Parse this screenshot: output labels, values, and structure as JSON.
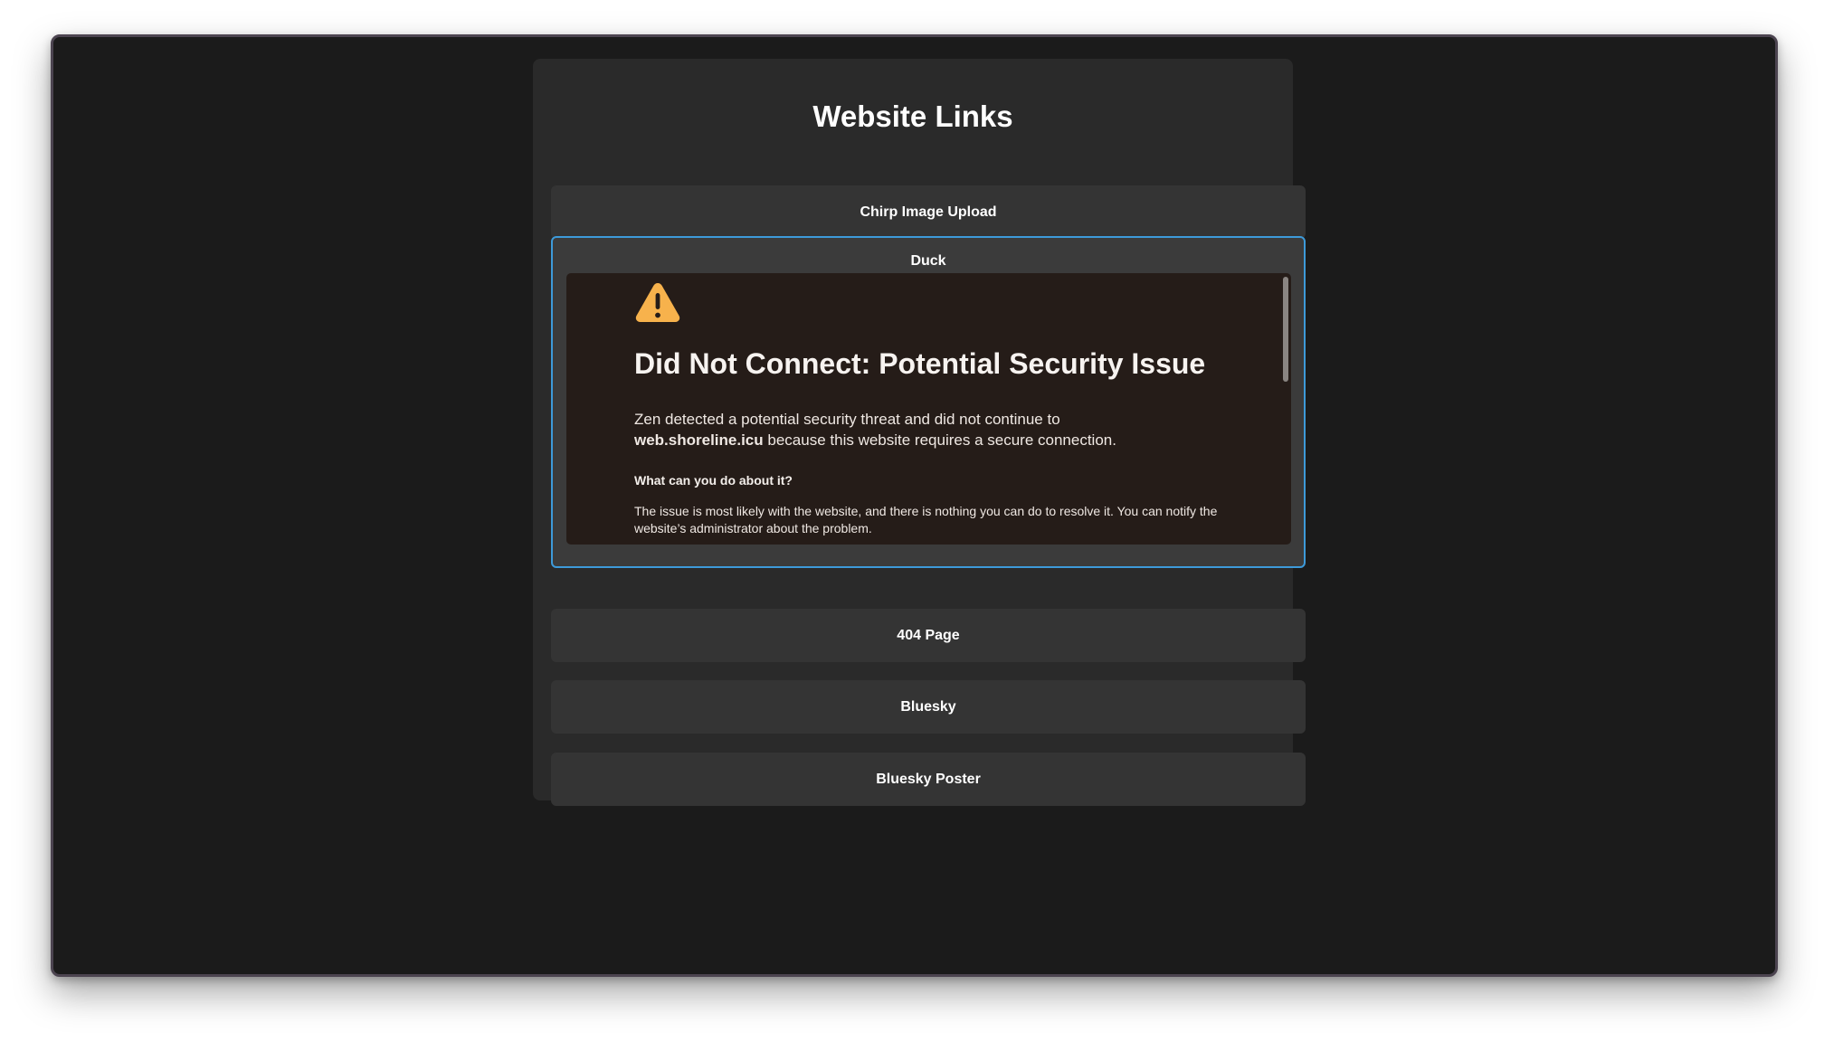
{
  "page": {
    "title": "Website Links"
  },
  "links": [
    {
      "label": "Chirp Image Upload"
    },
    {
      "label": "Duck"
    },
    {
      "label": "404 Page"
    },
    {
      "label": "Bluesky"
    },
    {
      "label": "Bluesky Poster"
    }
  ],
  "embedded_error": {
    "icon": "warning-triangle-icon",
    "icon_color": "#f7b24c",
    "title": "Did Not Connect: Potential Security Issue",
    "desc_prefix": "Zen detected a potential security threat and did not continue to",
    "host": "web.shoreline.icu",
    "desc_suffix": "because this website requires a secure connection.",
    "subheading": "What can you do about it?",
    "body": "The issue is most likely with the website, and there is nothing you can do to resolve it. You can notify the website’s administrator about the problem."
  },
  "colors": {
    "accent_border": "#3d9ad9",
    "background": "#1b1b1b",
    "panel": "#2a2a2a",
    "button": "#343434",
    "error_page_bg": "#251c18"
  }
}
